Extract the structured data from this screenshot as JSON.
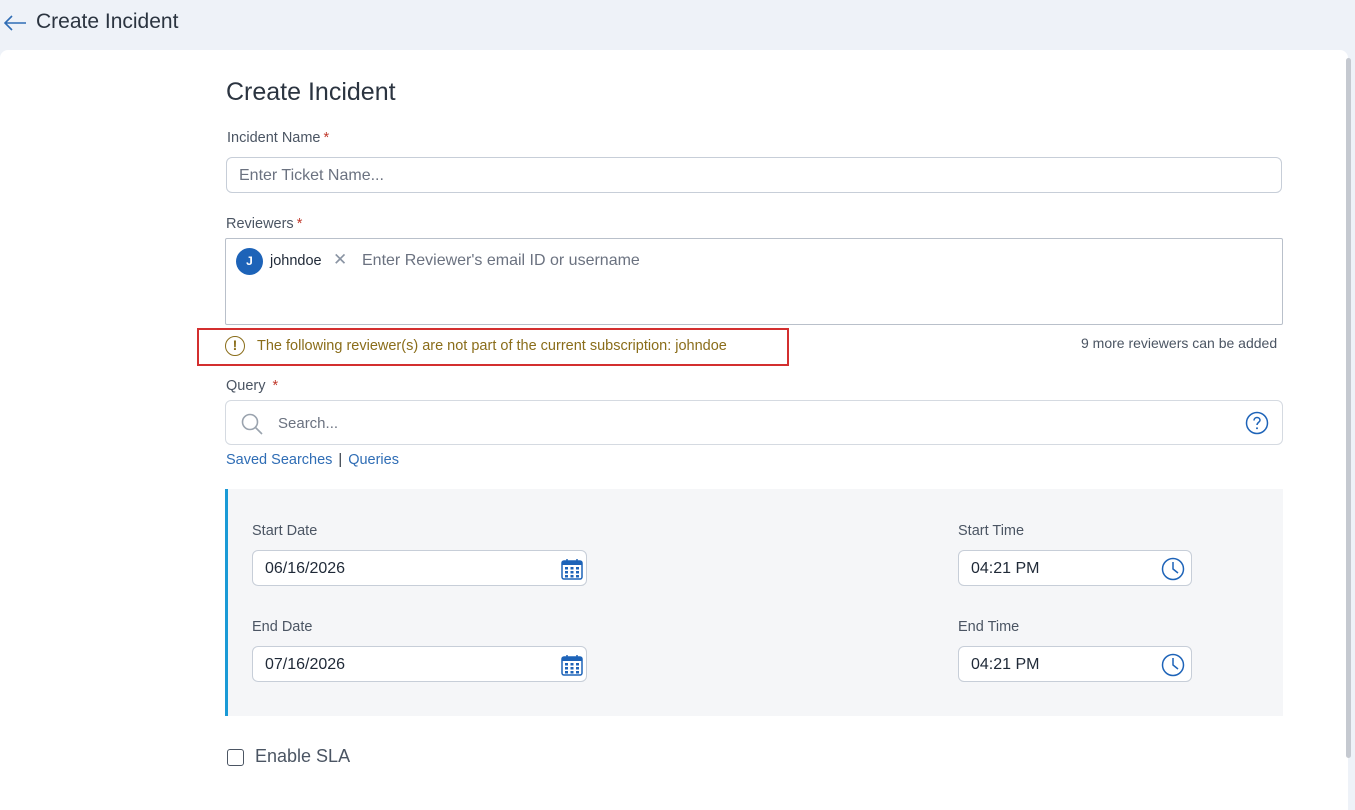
{
  "header": {
    "title": "Create Incident"
  },
  "form": {
    "title": "Create Incident",
    "incident_name": {
      "label": "Incident Name",
      "required_mark": "*",
      "placeholder": "Enter Ticket Name...",
      "value": ""
    },
    "reviewers": {
      "label": "Reviewers",
      "required_mark": "*",
      "chips": [
        {
          "initial": "J",
          "name": "johndoe"
        }
      ],
      "placeholder": "Enter Reviewer's email ID or username",
      "warning": "The following reviewer(s) are not part of the current subscription: johndoe",
      "more_text": "9 more reviewers can be added"
    },
    "query": {
      "label": "Query",
      "required_mark": "*",
      "placeholder": "Search...",
      "links": {
        "saved": "Saved Searches",
        "separator": "|",
        "queries": "Queries"
      }
    },
    "dates": {
      "start_date": {
        "label": "Start Date",
        "value": "06/16/2026"
      },
      "start_time": {
        "label": "Start Time",
        "value": "04:21 PM"
      },
      "end_date": {
        "label": "End Date",
        "value": "07/16/2026"
      },
      "end_time": {
        "label": "End Time",
        "value": "04:21 PM"
      }
    },
    "sla": {
      "label": "Enable SLA",
      "checked": false
    }
  },
  "colors": {
    "accent": "#1a9ad6",
    "link": "#2f6db5",
    "warning": "#8a6d1a",
    "highlight_border": "#d32f2f",
    "avatar": "#1d63b8"
  },
  "icons": {
    "back": "arrow-left-icon",
    "search": "search-icon",
    "help": "help-circle-icon",
    "calendar": "calendar-icon",
    "clock": "clock-icon",
    "warning": "exclamation-circle-icon",
    "remove": "close-icon"
  }
}
